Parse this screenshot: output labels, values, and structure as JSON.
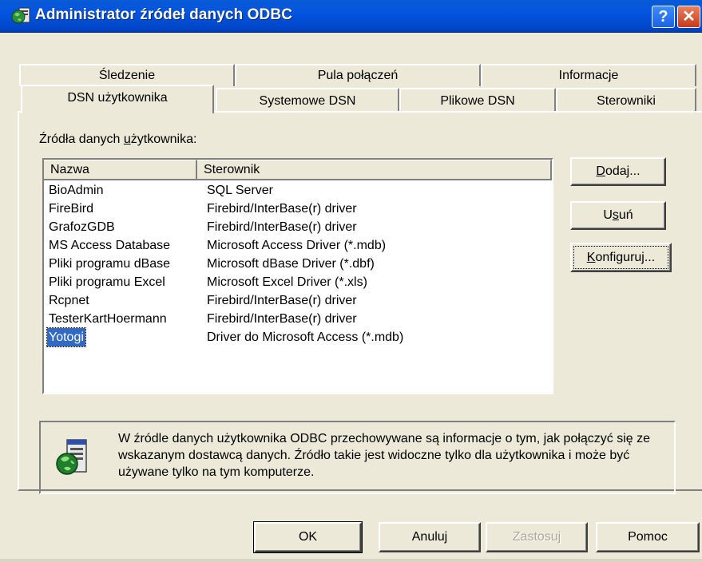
{
  "window": {
    "title": "Administrator źródeł danych ODBC",
    "help_button": "?",
    "close_button": "✕"
  },
  "tabs": {
    "row_back": [
      "Śledzenie",
      "Pula połączeń",
      "Informacje"
    ],
    "row_front": [
      "DSN użytkownika",
      "Systemowe DSN",
      "Plikowe DSN",
      "Sterowniki"
    ],
    "active": "DSN użytkownika"
  },
  "section_label": {
    "before": "Źródła danych ",
    "underlined": "u",
    "after": "żytkownika:"
  },
  "list": {
    "columns": [
      "Nazwa",
      "Sterownik"
    ],
    "rows": [
      {
        "name": "BioAdmin",
        "driver": "SQL Server"
      },
      {
        "name": "FireBird",
        "driver": "Firebird/InterBase(r) driver"
      },
      {
        "name": "GrafozGDB",
        "driver": "Firebird/InterBase(r) driver"
      },
      {
        "name": "MS Access Database",
        "driver": "Microsoft Access Driver (*.mdb)"
      },
      {
        "name": "Pliki programu dBase",
        "driver": "Microsoft dBase Driver (*.dbf)"
      },
      {
        "name": "Pliki programu Excel",
        "driver": "Microsoft Excel Driver (*.xls)"
      },
      {
        "name": "Rcpnet",
        "driver": "Firebird/InterBase(r) driver"
      },
      {
        "name": "TesterKartHoermann",
        "driver": "Firebird/InterBase(r) driver"
      },
      {
        "name": "Yotogi",
        "driver": "Driver do Microsoft Access (*.mdb)"
      }
    ],
    "selected": "Yotogi"
  },
  "side_buttons": {
    "add": {
      "underlined": "D",
      "rest": "odaj..."
    },
    "remove": {
      "before": "U",
      "underlined": "s",
      "rest": "uń"
    },
    "configure": {
      "underlined": "K",
      "rest": "onfiguruj..."
    }
  },
  "info": {
    "icon": "odbc-globe-database-icon",
    "text": "W źródle danych użytkownika ODBC przechowywane są informacje o tym, jak połączyć się ze wskazanym dostawcą danych. Źródło takie jest widoczne tylko dla użytkownika i może być używane tylko na tym komputerze."
  },
  "bottom_buttons": {
    "ok": "OK",
    "cancel": "Anuluj",
    "apply": "Zastosuj",
    "help": "Pomoc"
  },
  "colors": {
    "titlebar": "#0454e0",
    "dialog_bg": "#ece9d8",
    "selection": "#316ac5"
  }
}
